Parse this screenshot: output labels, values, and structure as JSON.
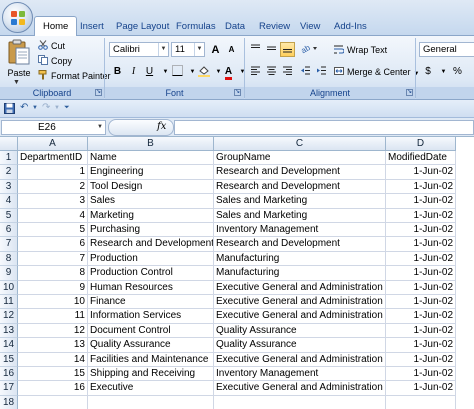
{
  "ribbon_tabs": [
    "Home",
    "Insert",
    "Page Layout",
    "Formulas",
    "Data",
    "Review",
    "View",
    "Add-Ins"
  ],
  "clipboard": {
    "paste": "Paste",
    "cut": "Cut",
    "copy": "Copy",
    "format_painter": "Format Painter",
    "group_label": "Clipboard"
  },
  "font": {
    "name": "Calibri",
    "size": "11",
    "group_label": "Font",
    "bold": "B",
    "italic": "I",
    "underline": "U",
    "grow": "A",
    "shrink": "A",
    "color_glyph": "A"
  },
  "alignment": {
    "wrap_text": "Wrap Text",
    "merge_center": "Merge & Center",
    "group_label": "Alignment"
  },
  "number": {
    "format": "General",
    "currency": "$",
    "percent": "%"
  },
  "formula_bar": {
    "cell_ref": "E26",
    "fx": "fx",
    "value": ""
  },
  "sheet": {
    "columns": [
      "A",
      "B",
      "C",
      "D"
    ],
    "row_numbers": [
      "1",
      "2",
      "3",
      "4",
      "5",
      "6",
      "7",
      "8",
      "9",
      "10",
      "11",
      "12",
      "13",
      "14",
      "15",
      "16",
      "17",
      "18"
    ],
    "rows": [
      [
        "DepartmentID",
        "Name",
        "GroupName",
        "ModifiedDate"
      ],
      [
        "1",
        "Engineering",
        "Research and Development",
        "1-Jun-02"
      ],
      [
        "2",
        "Tool Design",
        "Research and Development",
        "1-Jun-02"
      ],
      [
        "3",
        "Sales",
        "Sales and Marketing",
        "1-Jun-02"
      ],
      [
        "4",
        "Marketing",
        "Sales and Marketing",
        "1-Jun-02"
      ],
      [
        "5",
        "Purchasing",
        "Inventory Management",
        "1-Jun-02"
      ],
      [
        "6",
        "Research and Development",
        "Research and Development",
        "1-Jun-02"
      ],
      [
        "7",
        "Production",
        "Manufacturing",
        "1-Jun-02"
      ],
      [
        "8",
        "Production Control",
        "Manufacturing",
        "1-Jun-02"
      ],
      [
        "9",
        "Human Resources",
        "Executive General and Administration",
        "1-Jun-02"
      ],
      [
        "10",
        "Finance",
        "Executive General and Administration",
        "1-Jun-02"
      ],
      [
        "11",
        "Information Services",
        "Executive General and Administration",
        "1-Jun-02"
      ],
      [
        "12",
        "Document Control",
        "Quality Assurance",
        "1-Jun-02"
      ],
      [
        "13",
        "Quality Assurance",
        "Quality Assurance",
        "1-Jun-02"
      ],
      [
        "14",
        "Facilities and Maintenance",
        "Executive General and Administration",
        "1-Jun-02"
      ],
      [
        "15",
        "Shipping and Receiving",
        "Inventory Management",
        "1-Jun-02"
      ],
      [
        "16",
        "Executive",
        "Executive General and Administration",
        "1-Jun-02"
      ],
      [
        "",
        "",
        "",
        ""
      ]
    ]
  },
  "colors": {
    "ribbon_blue": "#15428b",
    "grid_line": "#d0d7e5",
    "highlight": "#ffd966"
  }
}
